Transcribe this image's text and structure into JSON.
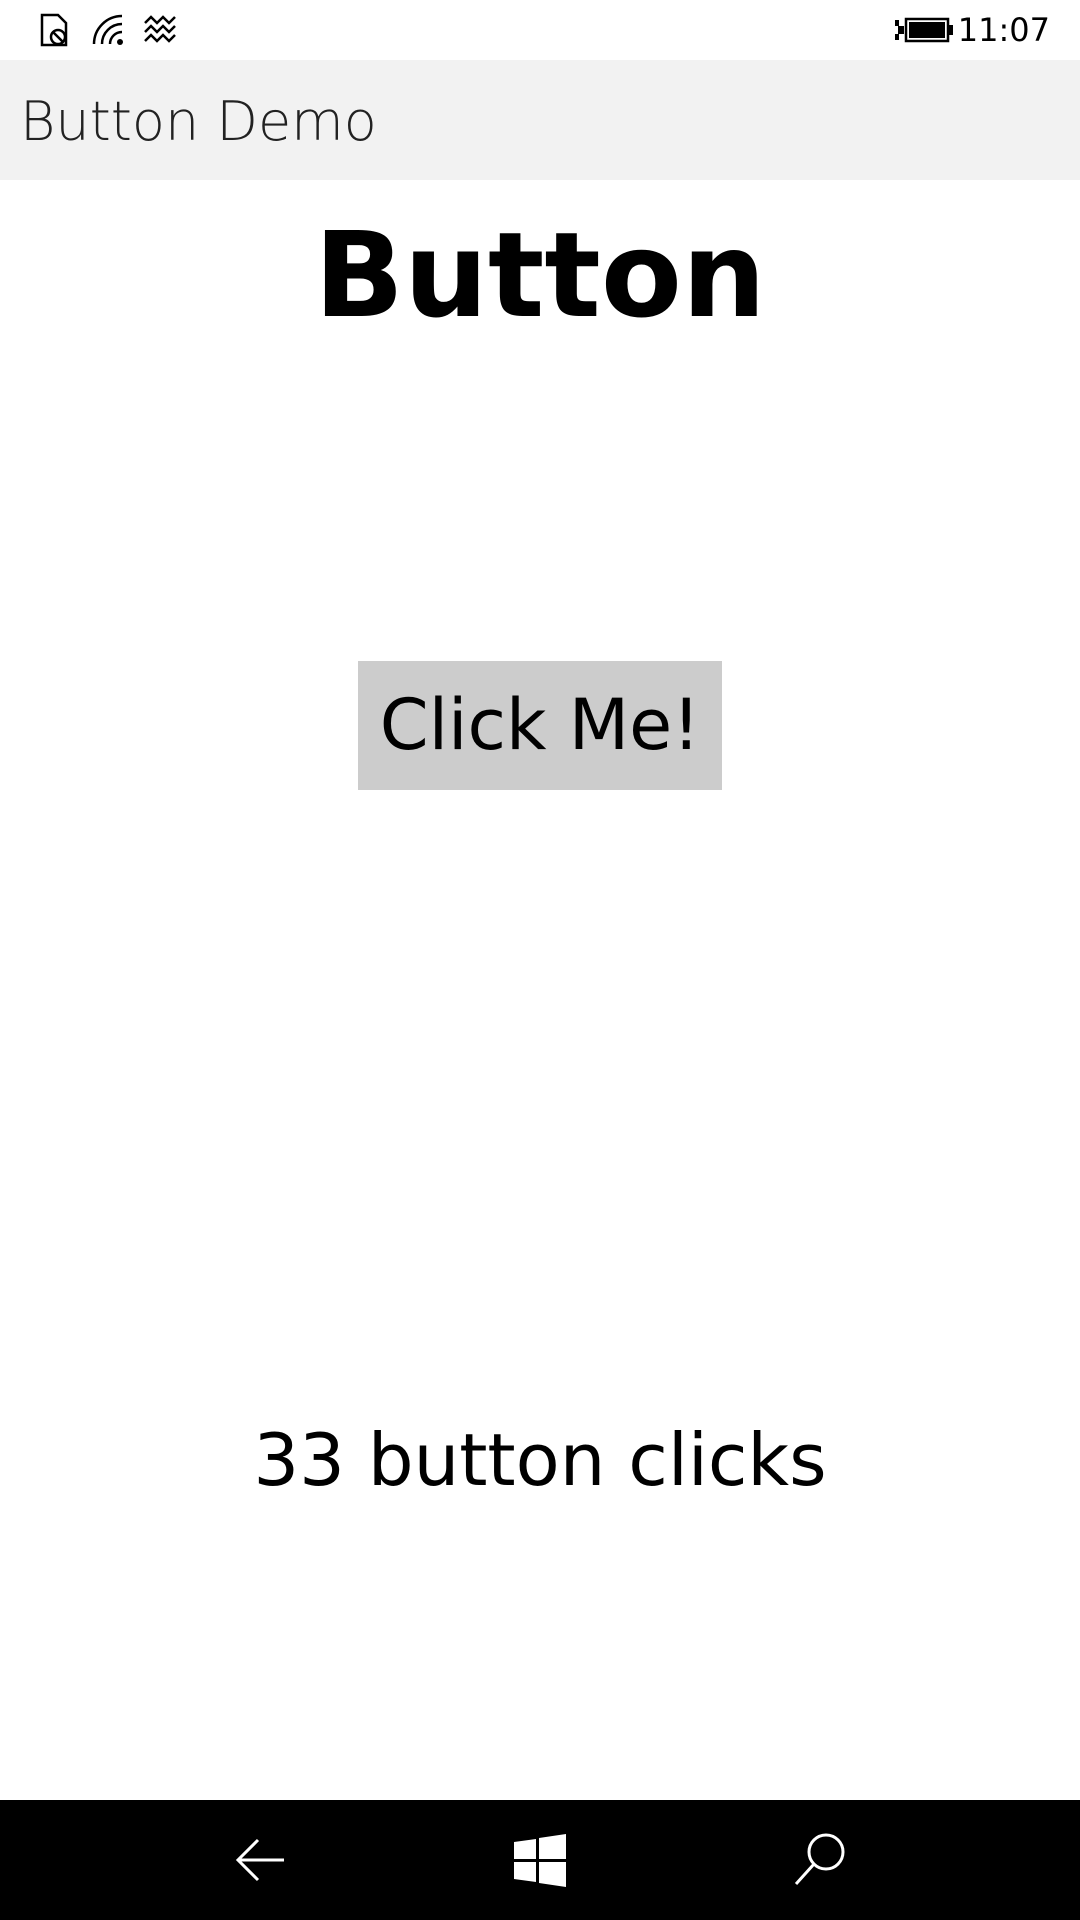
{
  "status_bar": {
    "time": "11:07",
    "icons": [
      "sim-blocked-icon",
      "wifi-icon",
      "vibrate-icon",
      "battery-charging-icon"
    ]
  },
  "app": {
    "title": "Button Demo"
  },
  "main": {
    "heading": "Button",
    "button_label": "Click Me!",
    "click_count_text": "33 button clicks"
  },
  "nav_bar": {
    "icons": [
      "back-arrow-icon",
      "windows-start-icon",
      "search-icon"
    ]
  },
  "colors": {
    "title_bar_bg": "#f2f2f2",
    "button_bg": "#cccccc",
    "nav_bar_bg": "#000000"
  }
}
